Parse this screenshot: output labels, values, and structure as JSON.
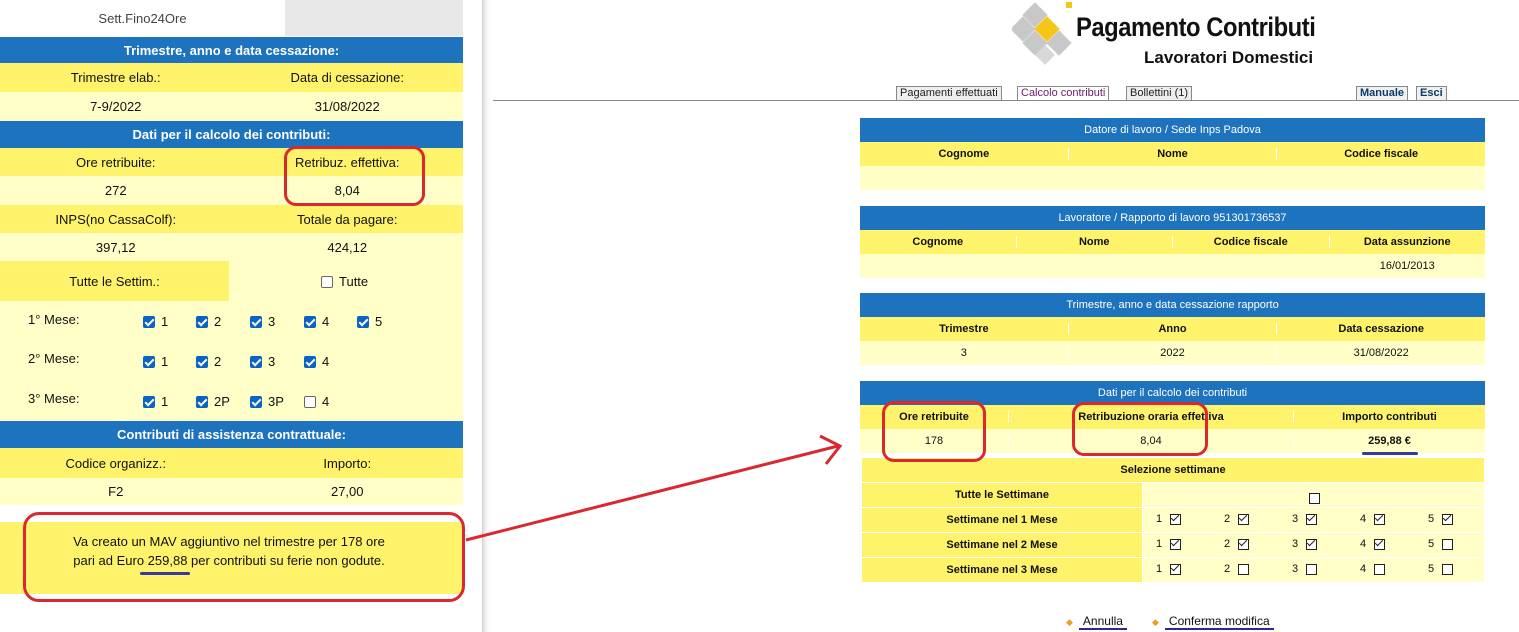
{
  "left": {
    "top_label": "Sett.Fino24Ore",
    "sec1_title": "Trimestre, anno e data cessazione:",
    "trimestre_label": "Trimestre elab.:",
    "cessazione_label": "Data di cessazione:",
    "trimestre_value": "7-9/2022",
    "cessazione_value": "31/08/2022",
    "sec2_title": "Dati per il calcolo dei contributi:",
    "ore_label": "Ore retribuite:",
    "retrib_label": "Retribuz. effettiva:",
    "ore_value": "272",
    "retrib_value": "8,04",
    "inps_label": "INPS(no CassaColf):",
    "totale_label": "Totale da pagare:",
    "inps_value": "397,12",
    "totale_value": "424,12",
    "tutte_settim_label": "Tutte le Settim.:",
    "tutte_label": "Tutte",
    "mese1_label": "1° Mese:",
    "mese2_label": "2° Mese:",
    "mese3_label": "3° Mese:",
    "mese1": [
      {
        "label": "1",
        "checked": true
      },
      {
        "label": "2",
        "checked": true
      },
      {
        "label": "3",
        "checked": true
      },
      {
        "label": "4",
        "checked": true
      },
      {
        "label": "5",
        "checked": true
      }
    ],
    "mese2": [
      {
        "label": "1",
        "checked": true
      },
      {
        "label": "2",
        "checked": true
      },
      {
        "label": "3",
        "checked": true
      },
      {
        "label": "4",
        "checked": true
      }
    ],
    "mese3": [
      {
        "label": "1",
        "checked": true
      },
      {
        "label": "2P",
        "checked": true
      },
      {
        "label": "3P",
        "checked": true
      },
      {
        "label": "4",
        "checked": false
      }
    ],
    "sec3_title": "Contributi di assistenza contrattuale:",
    "codice_label": "Codice organizz.:",
    "importo_label": "Importo:",
    "codice_value": "F2",
    "importo_value": "27,00",
    "note_line1": "Va creato un MAV aggiuntivo nel trimestre per 178 ore",
    "note_line2": "pari ad Euro 259,88 per contributi su ferie non godute."
  },
  "right": {
    "logo_title": "Pagamento Contributi",
    "logo_subtitle": "Lavoratori Domestici",
    "tabs": [
      "Pagamenti effettuati",
      "Calcolo contributi",
      "Bollettini (1)"
    ],
    "manuale": "Manuale",
    "esci": "Esci",
    "datore_title": "Datore di lavoro / Sede Inps Padova",
    "datore_cols": [
      "Cognome",
      "Nome",
      "Codice fiscale"
    ],
    "lavoratore_title": "Lavoratore / Rapporto di lavoro 951301736537",
    "lavoratore_cols": [
      "Cognome",
      "Nome",
      "Codice fiscale",
      "Data assunzione"
    ],
    "lavoratore_data_assunzione": "16/01/2013",
    "trimestre_title": "Trimestre, anno e data cessazione rapporto",
    "trimestre_cols": [
      "Trimestre",
      "Anno",
      "Data cessazione"
    ],
    "trimestre_vals": [
      "3",
      "2022",
      "31/08/2022"
    ],
    "calcolo_title": "Dati per il calcolo dei contributi",
    "calcolo_cols": [
      "Ore retribuite",
      "Retribuzione oraria effettiva",
      "Importo contributi"
    ],
    "calcolo_vals": [
      "178",
      "8,04",
      "259,88 €"
    ],
    "selezione_title": "Selezione settimane",
    "tutte_settimane": "Tutte le Settimane",
    "mesi": [
      {
        "label": "Settimane nel 1 Mese",
        "weeks": [
          {
            "n": "1",
            "on": true
          },
          {
            "n": "2",
            "on": true
          },
          {
            "n": "3",
            "on": true
          },
          {
            "n": "4",
            "on": true
          },
          {
            "n": "5",
            "on": true
          }
        ]
      },
      {
        "label": "Settimane nel 2 Mese",
        "weeks": [
          {
            "n": "1",
            "on": true
          },
          {
            "n": "2",
            "on": true
          },
          {
            "n": "3",
            "on": true
          },
          {
            "n": "4",
            "on": true
          },
          {
            "n": "5",
            "on": false
          }
        ]
      },
      {
        "label": "Settimane nel 3 Mese",
        "weeks": [
          {
            "n": "1",
            "on": true
          },
          {
            "n": "2",
            "on": false
          },
          {
            "n": "3",
            "on": false
          },
          {
            "n": "4",
            "on": false
          },
          {
            "n": "5",
            "on": false
          }
        ]
      }
    ],
    "annulla": "Annulla",
    "conferma": "Conferma modifica"
  },
  "colors": {
    "blue": "#1e73be",
    "yellow": "#fff36b",
    "light_yellow": "#ffffc8",
    "red": "#d9282f"
  }
}
